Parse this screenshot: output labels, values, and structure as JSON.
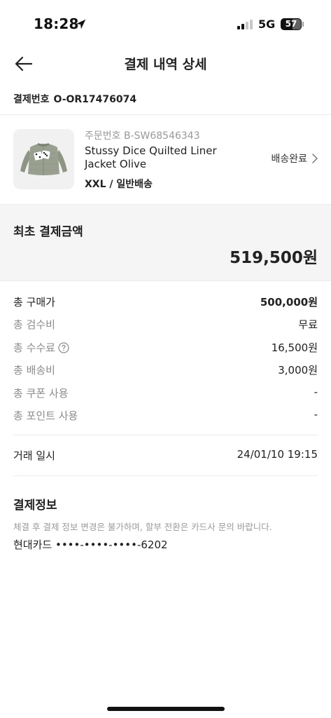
{
  "status_bar": {
    "time": "18:28",
    "network": "5G",
    "battery": "57",
    "icons": [
      "location-arrow-icon",
      "signal-bars-icon",
      "battery-icon"
    ]
  },
  "nav": {
    "title": "결제 내역 상세",
    "back_icon": "arrow-left-icon"
  },
  "payment": {
    "number_label": "결제번호",
    "number_value": "O-OR17476074"
  },
  "product": {
    "order_number": "주문번호 B-SW68546343",
    "name": "Stussy Dice Quilted Liner Jacket Olive",
    "option": "XXL / 일반배송",
    "status": "배송완료",
    "status_icon": "chevron-right-icon"
  },
  "initial_amount": {
    "label": "최초 결제금액",
    "value": "519,500원"
  },
  "breakdown": [
    {
      "label": "총 구매가",
      "value": "500,000원"
    },
    {
      "label": "총 검수비",
      "value": "무료"
    },
    {
      "label": "총 수수료",
      "value": "16,500원"
    },
    {
      "label": "총 배송비",
      "value": "3,000원"
    },
    {
      "label": "총 쿠폰 사용",
      "value": "-"
    },
    {
      "label": "총 포인트 사용",
      "value": "-"
    }
  ],
  "trade": {
    "label": "거래 일시",
    "value": "24/01/10 19:15"
  },
  "payment_info": {
    "title": "결제정보",
    "note": "체결 후 결제 정보 변경은 불가하며, 할부 전환은 카드사 문의 바랍니다.",
    "card": "현대카드 ••••-••••-••••-6202"
  },
  "colors": {
    "text": "#222222",
    "muted": "#8c8c8c",
    "section_bg": "#f5f5f5",
    "divider": "#ececec"
  }
}
